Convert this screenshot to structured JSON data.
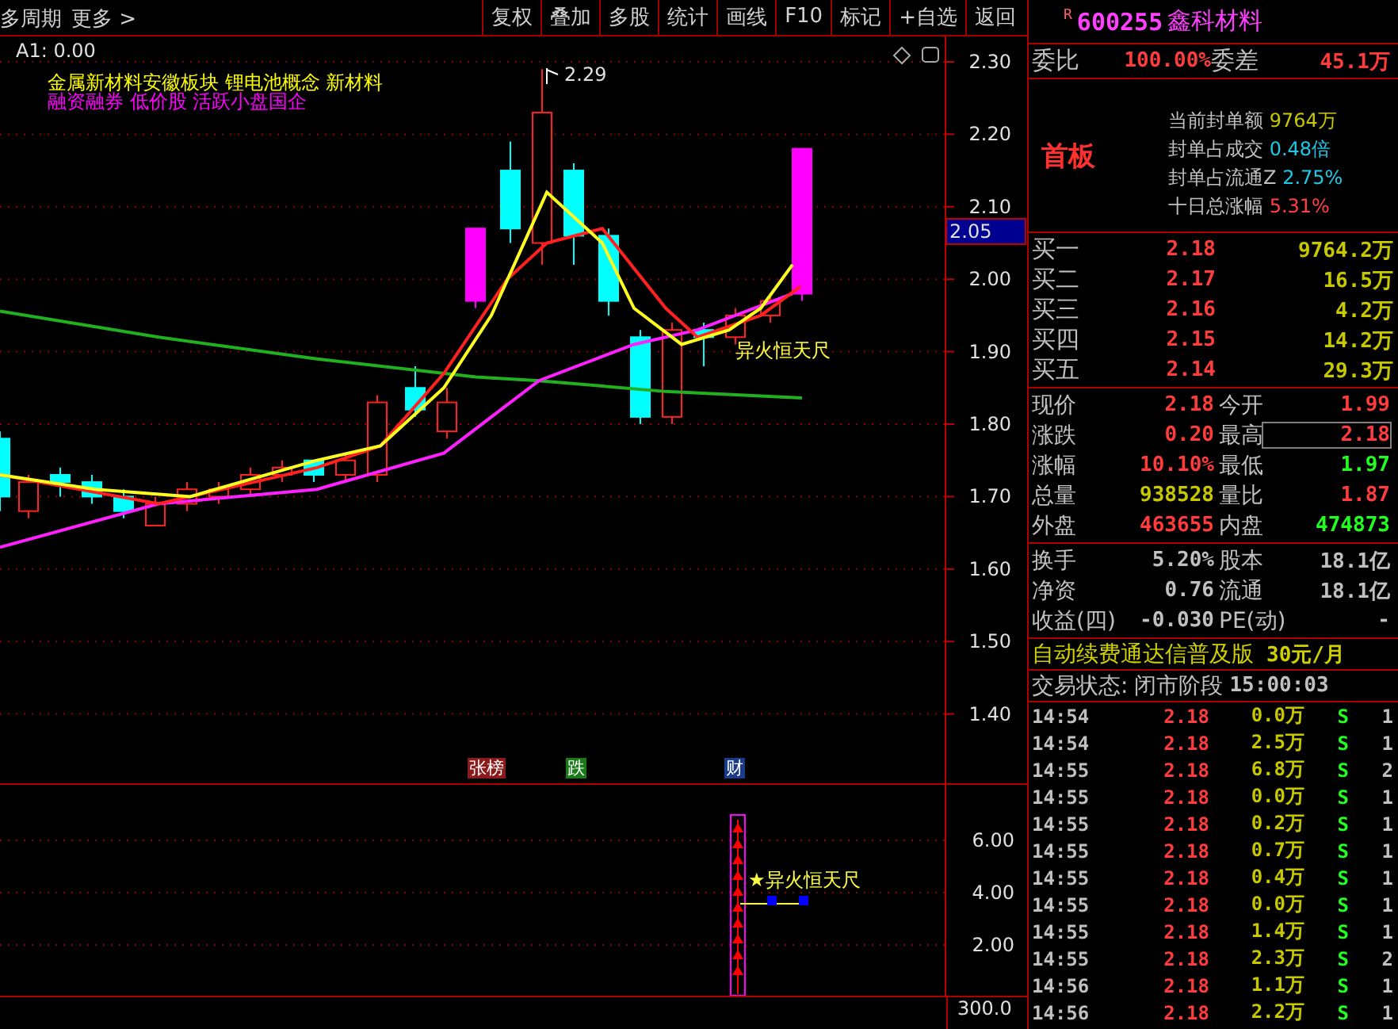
{
  "toolbar": {
    "period": "多周期",
    "more": "更多 >",
    "buttons": [
      "复权",
      "叠加",
      "多股",
      "统计",
      "画线",
      "F10",
      "标记",
      "+自选",
      "返回"
    ]
  },
  "chart": {
    "indicator": "A1: 0.00",
    "concepts": "金属新材料安徽板块  锂电池概念 新材料",
    "tags": "融资融券 低价股 活跃小盘国企",
    "high_label": "2.29",
    "signal_label": "异火恒天尺",
    "current_price": "2.05",
    "price_ticks": [
      "2.30",
      "2.20",
      "2.10",
      "2.00",
      "1.90",
      "1.80",
      "1.70",
      "1.60",
      "1.50",
      "1.40"
    ]
  },
  "markers": [
    {
      "label": "张榜",
      "color": "#8b1a1a"
    },
    {
      "label": "跌",
      "color": "#1a7a1a"
    },
    {
      "label": "财",
      "color": "#1a3a8a"
    }
  ],
  "sub_chart": {
    "signal_label": "★异火恒天尺",
    "ticks": [
      "6.00",
      "4.00",
      "2.00"
    ],
    "bottom_tick": "300.0"
  },
  "header": {
    "badge": "R",
    "code": "600255",
    "name": "鑫科材料"
  },
  "ratio": [
    {
      "label": "委比",
      "value": "100.00%"
    },
    {
      "label": "委差",
      "value": "45.1万"
    }
  ],
  "seal": {
    "title": "首板",
    "lines": [
      {
        "label": "当前封单额",
        "value": "9764万",
        "color": "#c8c800"
      },
      {
        "label": "封单占成交",
        "value": "0.48倍",
        "color": "#20c8e8"
      },
      {
        "label": "封单占流通Z",
        "value": "2.75%",
        "color": "#20c8e8"
      },
      {
        "label": "十日总涨幅",
        "value": "5.31%",
        "color": "#ff4040"
      }
    ]
  },
  "bids": [
    {
      "label": "买一",
      "price": "2.18",
      "volume": "9764.2万"
    },
    {
      "label": "买二",
      "price": "2.17",
      "volume": "16.5万"
    },
    {
      "label": "买三",
      "price": "2.16",
      "volume": "4.2万"
    },
    {
      "label": "买四",
      "price": "2.15",
      "volume": "14.2万"
    },
    {
      "label": "买五",
      "price": "2.14",
      "volume": "29.3万"
    }
  ],
  "quotes": [
    [
      {
        "label": "现价",
        "value": "2.18",
        "kind": "up",
        "boxed": false
      },
      {
        "label": "今开",
        "value": "1.99",
        "kind": "up",
        "boxed": false
      }
    ],
    [
      {
        "label": "涨跌",
        "value": "0.20",
        "kind": "up",
        "boxed": false
      },
      {
        "label": "最高",
        "value": "2.18",
        "kind": "up",
        "boxed": true
      }
    ],
    [
      {
        "label": "涨幅",
        "value": "10.10%",
        "kind": "up",
        "boxed": false
      },
      {
        "label": "最低",
        "value": "1.97",
        "kind": "down",
        "boxed": false
      }
    ],
    [
      {
        "label": "总量",
        "value": "938528",
        "kind": "volume",
        "boxed": false
      },
      {
        "label": "量比",
        "value": "1.87",
        "kind": "up",
        "boxed": false
      }
    ],
    [
      {
        "label": "外盘",
        "value": "463655",
        "kind": "up",
        "boxed": false
      },
      {
        "label": "内盘",
        "value": "474873",
        "kind": "down",
        "boxed": false
      }
    ]
  ],
  "stats": [
    [
      {
        "label": "换手",
        "value": "5.20%"
      },
      {
        "label": "股本",
        "value": "18.1亿"
      }
    ],
    [
      {
        "label": "净资",
        "value": "0.76"
      },
      {
        "label": "流通",
        "value": "18.1亿"
      }
    ],
    [
      {
        "label": "收益(四)",
        "value": "-0.030"
      },
      {
        "label": "PE(动)",
        "value": "-"
      }
    ]
  ],
  "ad": {
    "text": "自动续费通达信普及版",
    "price": "30元/月"
  },
  "status": {
    "label": "交易状态:",
    "value": "闭市阶段",
    "time": "15:00:03"
  },
  "trades": [
    {
      "time": "14:54",
      "price": "2.18",
      "volume": "0.0万",
      "side": "S",
      "count": "1"
    },
    {
      "time": "14:54",
      "price": "2.18",
      "volume": "2.5万",
      "side": "S",
      "count": "1"
    },
    {
      "time": "14:55",
      "price": "2.18",
      "volume": "6.8万",
      "side": "S",
      "count": "2"
    },
    {
      "time": "14:55",
      "price": "2.18",
      "volume": "0.0万",
      "side": "S",
      "count": "1"
    },
    {
      "time": "14:55",
      "price": "2.18",
      "volume": "0.2万",
      "side": "S",
      "count": "1"
    },
    {
      "time": "14:55",
      "price": "2.18",
      "volume": "0.7万",
      "side": "S",
      "count": "1"
    },
    {
      "time": "14:55",
      "price": "2.18",
      "volume": "0.4万",
      "side": "S",
      "count": "1"
    },
    {
      "time": "14:55",
      "price": "2.18",
      "volume": "0.0万",
      "side": "S",
      "count": "1"
    },
    {
      "time": "14:55",
      "price": "2.18",
      "volume": "1.4万",
      "side": "S",
      "count": "1"
    },
    {
      "time": "14:55",
      "price": "2.18",
      "volume": "2.3万",
      "side": "S",
      "count": "2"
    },
    {
      "time": "14:56",
      "price": "2.18",
      "volume": "1.1万",
      "side": "S",
      "count": "1"
    },
    {
      "time": "14:56",
      "price": "2.18",
      "volume": "2.2万",
      "side": "S",
      "count": "1"
    }
  ]
}
